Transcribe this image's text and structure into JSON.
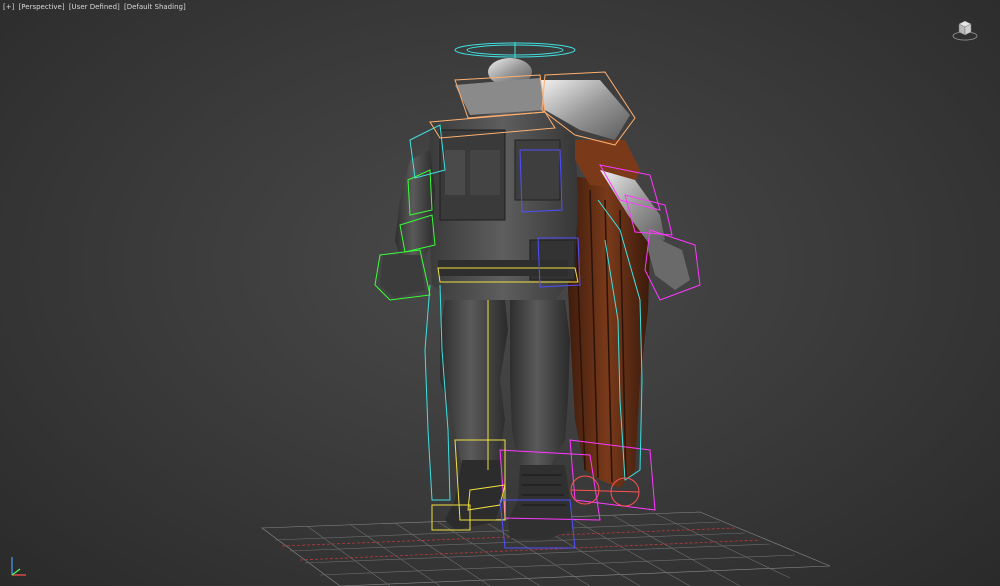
{
  "viewport": {
    "menu_label": "[+]",
    "view_label": "[Perspective]",
    "camera_label": "[User Defined]",
    "shading_label": "[Default Shading]"
  },
  "colors": {
    "background": "#3a3a3a",
    "grid_major": "#7a7a7a",
    "grid_x_axis": "#b83a3a",
    "wire_green": "#39ff39",
    "wire_magenta": "#ff38ff",
    "wire_yellow": "#f0e040",
    "wire_cyan": "#40e0e0",
    "wire_blue": "#3a3aff",
    "wire_orange": "#ffb070",
    "wire_red": "#ff5050",
    "cape_brown": "#6e3217",
    "armor_grey": "#5a5a5a"
  },
  "icons": {
    "viewcube": "viewcube-icon",
    "axis": "axis-tripod-icon"
  }
}
